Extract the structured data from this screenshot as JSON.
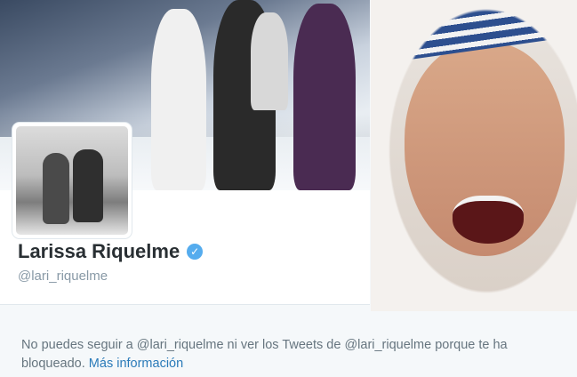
{
  "profile": {
    "display_name": "Larissa Riquelme",
    "handle": "@lari_riquelme",
    "verified": true
  },
  "blocked_notice": {
    "text": "No puedes seguir a @lari_riquelme ni ver los Tweets de @lari_riquelme porque te ha bloqueado.",
    "link_label": "Más información"
  },
  "icons": {
    "verified": "verified-badge-icon"
  },
  "colors": {
    "link": "#2b7bb9",
    "verified": "#55acee",
    "name": "#292f33",
    "muted": "#8899a6"
  }
}
